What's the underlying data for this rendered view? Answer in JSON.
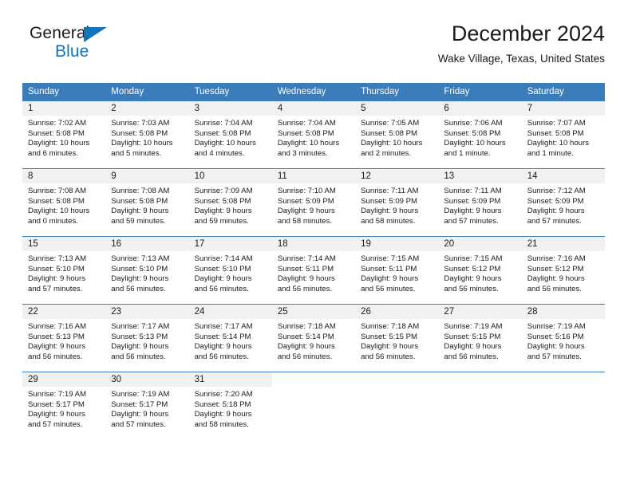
{
  "brand": {
    "name_part1": "General",
    "name_part2": "Blue",
    "flag_icon": "blue-triangle-flag-icon"
  },
  "header": {
    "month_title": "December 2024",
    "location": "Wake Village, Texas, United States"
  },
  "colors": {
    "header_blue": "#3b7dba",
    "brand_blue": "#1175bb",
    "daynum_gray": "#f1f1f1",
    "text": "#1a1a1a"
  },
  "weekday_headers": [
    "Sunday",
    "Monday",
    "Tuesday",
    "Wednesday",
    "Thursday",
    "Friday",
    "Saturday"
  ],
  "weeks": [
    [
      {
        "day": "1",
        "sunrise": "Sunrise: 7:02 AM",
        "sunset": "Sunset: 5:08 PM",
        "daylight1": "Daylight: 10 hours",
        "daylight2": "and 6 minutes."
      },
      {
        "day": "2",
        "sunrise": "Sunrise: 7:03 AM",
        "sunset": "Sunset: 5:08 PM",
        "daylight1": "Daylight: 10 hours",
        "daylight2": "and 5 minutes."
      },
      {
        "day": "3",
        "sunrise": "Sunrise: 7:04 AM",
        "sunset": "Sunset: 5:08 PM",
        "daylight1": "Daylight: 10 hours",
        "daylight2": "and 4 minutes."
      },
      {
        "day": "4",
        "sunrise": "Sunrise: 7:04 AM",
        "sunset": "Sunset: 5:08 PM",
        "daylight1": "Daylight: 10 hours",
        "daylight2": "and 3 minutes."
      },
      {
        "day": "5",
        "sunrise": "Sunrise: 7:05 AM",
        "sunset": "Sunset: 5:08 PM",
        "daylight1": "Daylight: 10 hours",
        "daylight2": "and 2 minutes."
      },
      {
        "day": "6",
        "sunrise": "Sunrise: 7:06 AM",
        "sunset": "Sunset: 5:08 PM",
        "daylight1": "Daylight: 10 hours",
        "daylight2": "and 1 minute."
      },
      {
        "day": "7",
        "sunrise": "Sunrise: 7:07 AM",
        "sunset": "Sunset: 5:08 PM",
        "daylight1": "Daylight: 10 hours",
        "daylight2": "and 1 minute."
      }
    ],
    [
      {
        "day": "8",
        "sunrise": "Sunrise: 7:08 AM",
        "sunset": "Sunset: 5:08 PM",
        "daylight1": "Daylight: 10 hours",
        "daylight2": "and 0 minutes."
      },
      {
        "day": "9",
        "sunrise": "Sunrise: 7:08 AM",
        "sunset": "Sunset: 5:08 PM",
        "daylight1": "Daylight: 9 hours",
        "daylight2": "and 59 minutes."
      },
      {
        "day": "10",
        "sunrise": "Sunrise: 7:09 AM",
        "sunset": "Sunset: 5:08 PM",
        "daylight1": "Daylight: 9 hours",
        "daylight2": "and 59 minutes."
      },
      {
        "day": "11",
        "sunrise": "Sunrise: 7:10 AM",
        "sunset": "Sunset: 5:09 PM",
        "daylight1": "Daylight: 9 hours",
        "daylight2": "and 58 minutes."
      },
      {
        "day": "12",
        "sunrise": "Sunrise: 7:11 AM",
        "sunset": "Sunset: 5:09 PM",
        "daylight1": "Daylight: 9 hours",
        "daylight2": "and 58 minutes."
      },
      {
        "day": "13",
        "sunrise": "Sunrise: 7:11 AM",
        "sunset": "Sunset: 5:09 PM",
        "daylight1": "Daylight: 9 hours",
        "daylight2": "and 57 minutes."
      },
      {
        "day": "14",
        "sunrise": "Sunrise: 7:12 AM",
        "sunset": "Sunset: 5:09 PM",
        "daylight1": "Daylight: 9 hours",
        "daylight2": "and 57 minutes."
      }
    ],
    [
      {
        "day": "15",
        "sunrise": "Sunrise: 7:13 AM",
        "sunset": "Sunset: 5:10 PM",
        "daylight1": "Daylight: 9 hours",
        "daylight2": "and 57 minutes."
      },
      {
        "day": "16",
        "sunrise": "Sunrise: 7:13 AM",
        "sunset": "Sunset: 5:10 PM",
        "daylight1": "Daylight: 9 hours",
        "daylight2": "and 56 minutes."
      },
      {
        "day": "17",
        "sunrise": "Sunrise: 7:14 AM",
        "sunset": "Sunset: 5:10 PM",
        "daylight1": "Daylight: 9 hours",
        "daylight2": "and 56 minutes."
      },
      {
        "day": "18",
        "sunrise": "Sunrise: 7:14 AM",
        "sunset": "Sunset: 5:11 PM",
        "daylight1": "Daylight: 9 hours",
        "daylight2": "and 56 minutes."
      },
      {
        "day": "19",
        "sunrise": "Sunrise: 7:15 AM",
        "sunset": "Sunset: 5:11 PM",
        "daylight1": "Daylight: 9 hours",
        "daylight2": "and 56 minutes."
      },
      {
        "day": "20",
        "sunrise": "Sunrise: 7:15 AM",
        "sunset": "Sunset: 5:12 PM",
        "daylight1": "Daylight: 9 hours",
        "daylight2": "and 56 minutes."
      },
      {
        "day": "21",
        "sunrise": "Sunrise: 7:16 AM",
        "sunset": "Sunset: 5:12 PM",
        "daylight1": "Daylight: 9 hours",
        "daylight2": "and 56 minutes."
      }
    ],
    [
      {
        "day": "22",
        "sunrise": "Sunrise: 7:16 AM",
        "sunset": "Sunset: 5:13 PM",
        "daylight1": "Daylight: 9 hours",
        "daylight2": "and 56 minutes."
      },
      {
        "day": "23",
        "sunrise": "Sunrise: 7:17 AM",
        "sunset": "Sunset: 5:13 PM",
        "daylight1": "Daylight: 9 hours",
        "daylight2": "and 56 minutes."
      },
      {
        "day": "24",
        "sunrise": "Sunrise: 7:17 AM",
        "sunset": "Sunset: 5:14 PM",
        "daylight1": "Daylight: 9 hours",
        "daylight2": "and 56 minutes."
      },
      {
        "day": "25",
        "sunrise": "Sunrise: 7:18 AM",
        "sunset": "Sunset: 5:14 PM",
        "daylight1": "Daylight: 9 hours",
        "daylight2": "and 56 minutes."
      },
      {
        "day": "26",
        "sunrise": "Sunrise: 7:18 AM",
        "sunset": "Sunset: 5:15 PM",
        "daylight1": "Daylight: 9 hours",
        "daylight2": "and 56 minutes."
      },
      {
        "day": "27",
        "sunrise": "Sunrise: 7:19 AM",
        "sunset": "Sunset: 5:15 PM",
        "daylight1": "Daylight: 9 hours",
        "daylight2": "and 56 minutes."
      },
      {
        "day": "28",
        "sunrise": "Sunrise: 7:19 AM",
        "sunset": "Sunset: 5:16 PM",
        "daylight1": "Daylight: 9 hours",
        "daylight2": "and 57 minutes."
      }
    ],
    [
      {
        "day": "29",
        "sunrise": "Sunrise: 7:19 AM",
        "sunset": "Sunset: 5:17 PM",
        "daylight1": "Daylight: 9 hours",
        "daylight2": "and 57 minutes."
      },
      {
        "day": "30",
        "sunrise": "Sunrise: 7:19 AM",
        "sunset": "Sunset: 5:17 PM",
        "daylight1": "Daylight: 9 hours",
        "daylight2": "and 57 minutes."
      },
      {
        "day": "31",
        "sunrise": "Sunrise: 7:20 AM",
        "sunset": "Sunset: 5:18 PM",
        "daylight1": "Daylight: 9 hours",
        "daylight2": "and 58 minutes."
      },
      {
        "day": "",
        "sunrise": "",
        "sunset": "",
        "daylight1": "",
        "daylight2": ""
      },
      {
        "day": "",
        "sunrise": "",
        "sunset": "",
        "daylight1": "",
        "daylight2": ""
      },
      {
        "day": "",
        "sunrise": "",
        "sunset": "",
        "daylight1": "",
        "daylight2": ""
      },
      {
        "day": "",
        "sunrise": "",
        "sunset": "",
        "daylight1": "",
        "daylight2": ""
      }
    ]
  ]
}
